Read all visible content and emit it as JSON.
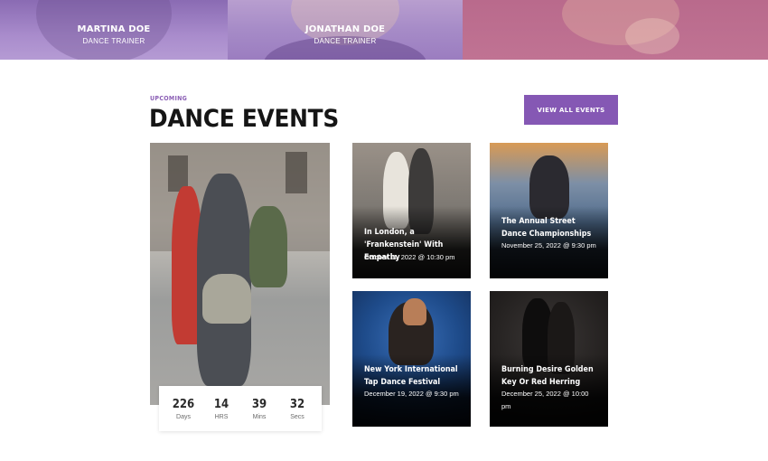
{
  "trainers": [
    {
      "name": "MARTINA DOE",
      "role": "DANCE TRAINER"
    },
    {
      "name": "JONATHAN DOE",
      "role": "DANCE TRAINER"
    }
  ],
  "section": {
    "kicker": "UPCOMING",
    "title": "DANCE EVENTS",
    "view_all_label": "VIEW ALL EVENTS"
  },
  "countdown": [
    {
      "value": "226",
      "label": "Days"
    },
    {
      "value": "14",
      "label": "HRS"
    },
    {
      "value": "39",
      "label": "Mins"
    },
    {
      "value": "32",
      "label": "Secs"
    }
  ],
  "events": [
    {
      "title": "In London, a 'Frankenstein' With Empathy",
      "date": "October 11, 2022 @ 10:30 pm"
    },
    {
      "title": "The Annual Street Dance Championships",
      "date": "November 25, 2022 @ 9:30 pm"
    },
    {
      "title": "New York International Tap Dance Festival",
      "date": "December 19, 2022 @ 9:30 pm"
    },
    {
      "title": "Burning Desire Golden Key Or Red Herring",
      "date": "December 25, 2022 @ 10:00 pm"
    }
  ],
  "colors": {
    "accent": "#8558b4",
    "kicker": "#8b5fb5"
  }
}
